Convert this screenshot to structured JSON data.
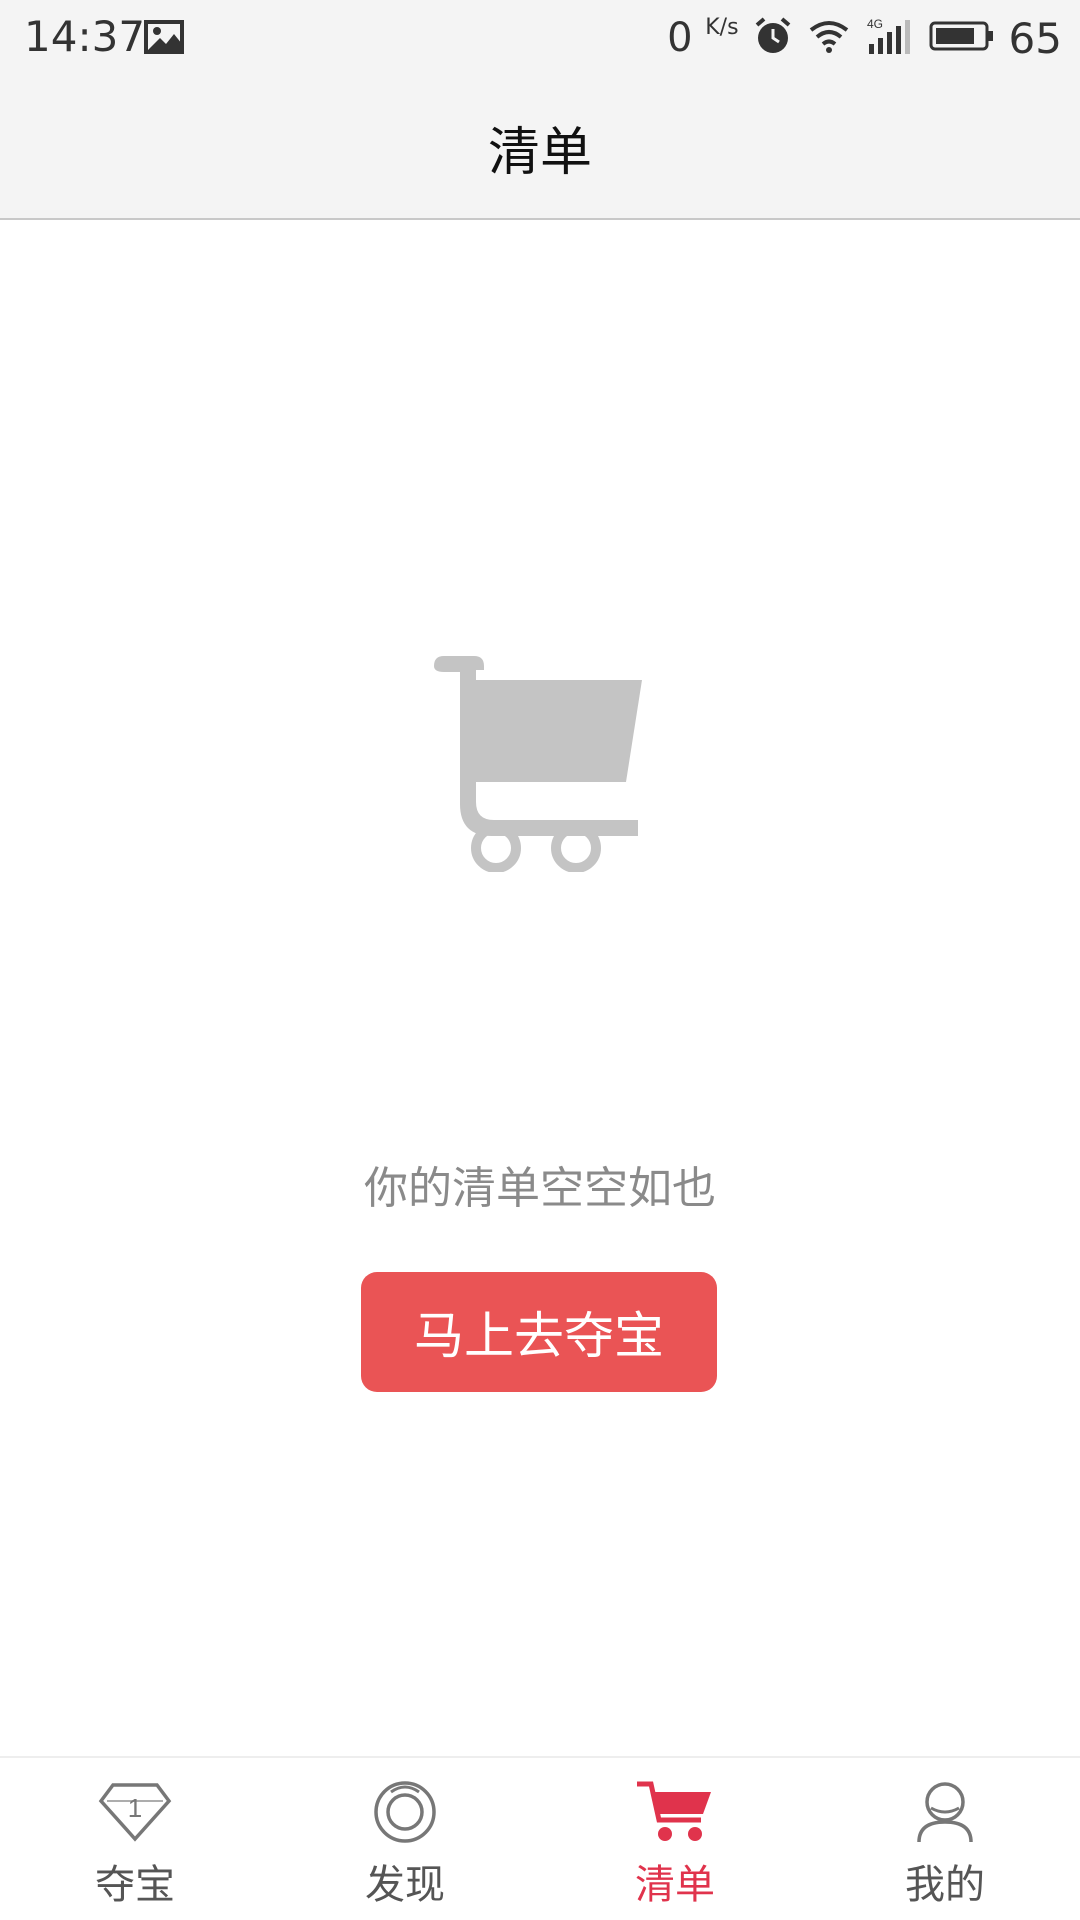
{
  "status_bar": {
    "time": "14:37",
    "net_speed_value": "0",
    "net_speed_unit": "K/s",
    "battery": "65",
    "icons": [
      "image-icon",
      "alarm-icon",
      "wifi-icon",
      "signal-4g-icon",
      "battery-icon"
    ]
  },
  "header": {
    "title": "清单"
  },
  "empty_state": {
    "illustration": "shopping-cart-icon",
    "message": "你的清单空空如也",
    "button_label": "马上去夺宝"
  },
  "tabbar": {
    "tabs": [
      {
        "label": "夺宝",
        "icon": "diamond-icon",
        "active": false
      },
      {
        "label": "发现",
        "icon": "discover-icon",
        "active": false
      },
      {
        "label": "清单",
        "icon": "cart-icon",
        "active": true
      },
      {
        "label": "我的",
        "icon": "user-icon",
        "active": false
      }
    ]
  },
  "colors": {
    "accent": "#e0334c",
    "button": "#ea5455",
    "illustration": "#c4c4c4",
    "bar_bg": "#f4f4f4"
  }
}
